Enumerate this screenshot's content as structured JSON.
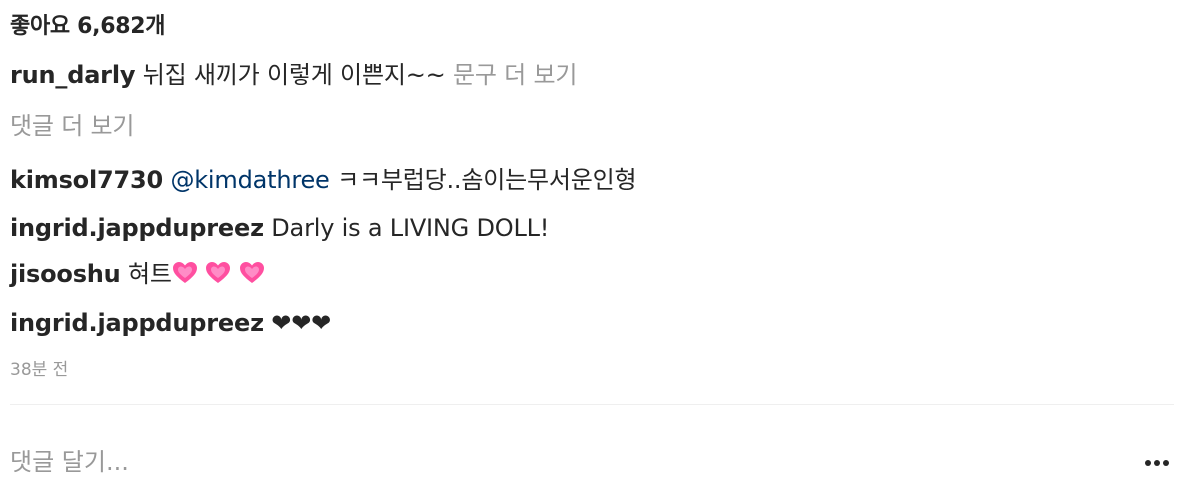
{
  "likes": {
    "text": "좋아요 6,682개"
  },
  "caption": {
    "user": "run_darly",
    "text": "뉘집 새끼가 이렇게 이쁜지~~",
    "more": "문구 더 보기"
  },
  "view_more_comments": "댓글 더 보기",
  "comments": [
    {
      "user": "kimsol7730",
      "mention": "@kimdathree",
      "text": "ㅋㅋ부럽당..솜이는무서운인형"
    },
    {
      "user": "ingrid.jappdupreez",
      "text": "Darly is a LIVING DOLL!"
    },
    {
      "user": "jisooshu",
      "text": "혀트",
      "emoji": "pink-heart"
    },
    {
      "user": "ingrid.jappdupreez",
      "text": "❤❤❤"
    }
  ],
  "timestamp": "38분 전",
  "comment_input": {
    "placeholder": "댓글 달기..."
  },
  "colors": {
    "text": "#262626",
    "muted": "#999999",
    "mention": "#003569",
    "pink_heart": "#ff4fa0"
  },
  "icons": {
    "more": "more-horizontal-icon",
    "heart": "growing-heart-icon"
  }
}
